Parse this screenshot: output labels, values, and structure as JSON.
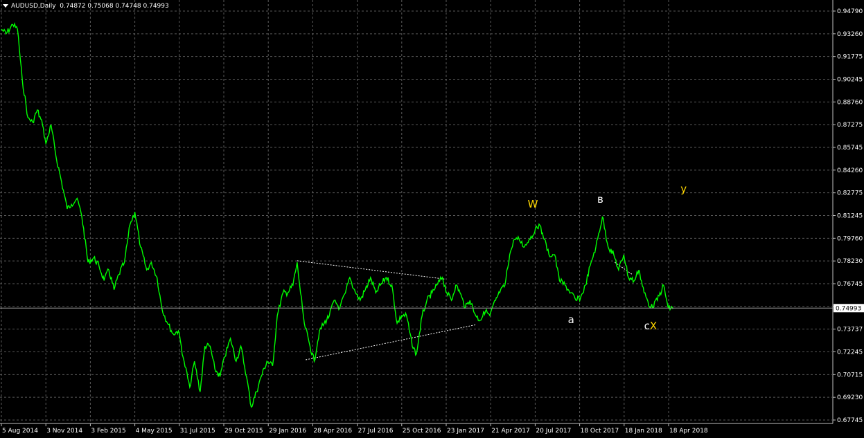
{
  "header": {
    "symbol": "AUDUSD,Daily",
    "ohlc": "0.74872 0.75068 0.74748 0.74993"
  },
  "colors": {
    "background": "#000000",
    "grid": "#5a5a5a",
    "price_line": "#00ff00",
    "axis_text": "#ffffff",
    "wave_label_yellow": "#ffd700",
    "wave_label_white": "#ffffff",
    "trendline": "#ffffff"
  },
  "chart_data": {
    "type": "line",
    "title": "",
    "xlabel": "",
    "ylabel": "",
    "ylim": [
      0.6774,
      0.9476
    ],
    "grid": true,
    "y_ticks": [
      "0.94790",
      "0.93260",
      "0.91775",
      "0.90245",
      "0.88760",
      "0.87275",
      "0.85745",
      "0.84260",
      "0.82775",
      "0.81245",
      "0.79760",
      "0.78230",
      "0.76745",
      "0.75260",
      "0.73737",
      "0.72245",
      "0.70715",
      "0.69230",
      "0.67745"
    ],
    "current_price": "0.74993",
    "x_ticks": [
      "5 Aug 2014",
      "3 Nov 2014",
      "3 Feb 2015",
      "4 May 2015",
      "31 Jul 2015",
      "29 Oct 2015",
      "29 Jan 2016",
      "28 Apr 2016",
      "27 Jul 2016",
      "25 Oct 2016",
      "23 Jan 2017",
      "21 Apr 2017",
      "20 Jul 2017",
      "18 Oct 2017",
      "18 Jan 2018",
      "18 Apr 2018"
    ],
    "x_range": [
      "2014-08-05",
      "2018-06-25"
    ],
    "series": [
      {
        "points": [
          [
            "2014-08-05",
            0.933
          ],
          [
            "2014-08-15",
            0.93
          ],
          [
            "2014-08-29",
            0.936
          ],
          [
            "2014-09-08",
            0.933
          ],
          [
            "2014-09-18",
            0.9
          ],
          [
            "2014-09-30",
            0.875
          ],
          [
            "2014-10-10",
            0.872
          ],
          [
            "2014-10-20",
            0.88
          ],
          [
            "2014-10-31",
            0.87
          ],
          [
            "2014-11-07",
            0.858
          ],
          [
            "2014-11-18",
            0.87
          ],
          [
            "2014-11-28",
            0.85
          ],
          [
            "2014-12-10",
            0.833
          ],
          [
            "2014-12-22",
            0.815
          ],
          [
            "2014-12-31",
            0.818
          ],
          [
            "2015-01-12",
            0.822
          ],
          [
            "2015-01-22",
            0.81
          ],
          [
            "2015-02-04",
            0.78
          ],
          [
            "2015-02-16",
            0.783
          ],
          [
            "2015-02-27",
            0.778
          ],
          [
            "2015-03-10",
            0.768
          ],
          [
            "2015-03-20",
            0.775
          ],
          [
            "2015-03-31",
            0.762
          ],
          [
            "2015-04-10",
            0.772
          ],
          [
            "2015-04-22",
            0.78
          ],
          [
            "2015-05-04",
            0.805
          ],
          [
            "2015-05-14",
            0.813
          ],
          [
            "2015-05-26",
            0.79
          ],
          [
            "2015-06-08",
            0.775
          ],
          [
            "2015-06-18",
            0.78
          ],
          [
            "2015-06-30",
            0.77
          ],
          [
            "2015-07-10",
            0.75
          ],
          [
            "2015-07-22",
            0.74
          ],
          [
            "2015-08-03",
            0.733
          ],
          [
            "2015-08-14",
            0.735
          ],
          [
            "2015-08-26",
            0.715
          ],
          [
            "2015-09-07",
            0.698
          ],
          [
            "2015-09-17",
            0.715
          ],
          [
            "2015-09-29",
            0.695
          ],
          [
            "2015-10-09",
            0.725
          ],
          [
            "2015-10-20",
            0.725
          ],
          [
            "2015-10-30",
            0.71
          ],
          [
            "2015-11-10",
            0.705
          ],
          [
            "2015-11-20",
            0.718
          ],
          [
            "2015-12-02",
            0.73
          ],
          [
            "2015-12-14",
            0.715
          ],
          [
            "2015-12-24",
            0.725
          ],
          [
            "2016-01-05",
            0.705
          ],
          [
            "2016-01-15",
            0.685
          ],
          [
            "2016-01-26",
            0.695
          ],
          [
            "2016-02-05",
            0.705
          ],
          [
            "2016-02-17",
            0.715
          ],
          [
            "2016-02-29",
            0.712
          ],
          [
            "2016-03-10",
            0.745
          ],
          [
            "2016-03-22",
            0.76
          ],
          [
            "2016-04-01",
            0.76
          ],
          [
            "2016-04-12",
            0.765
          ],
          [
            "2016-04-21",
            0.78
          ],
          [
            "2016-04-28",
            0.76
          ],
          [
            "2016-05-06",
            0.74
          ],
          [
            "2016-05-18",
            0.725
          ],
          [
            "2016-05-27",
            0.715
          ],
          [
            "2016-06-07",
            0.735
          ],
          [
            "2016-06-17",
            0.74
          ],
          [
            "2016-06-28",
            0.745
          ],
          [
            "2016-07-08",
            0.755
          ],
          [
            "2016-07-20",
            0.75
          ],
          [
            "2016-08-01",
            0.76
          ],
          [
            "2016-08-10",
            0.77
          ],
          [
            "2016-08-22",
            0.76
          ],
          [
            "2016-09-01",
            0.755
          ],
          [
            "2016-09-12",
            0.762
          ],
          [
            "2016-09-23",
            0.77
          ],
          [
            "2016-10-04",
            0.76
          ],
          [
            "2016-10-14",
            0.765
          ],
          [
            "2016-10-26",
            0.77
          ],
          [
            "2016-11-07",
            0.765
          ],
          [
            "2016-11-18",
            0.74
          ],
          [
            "2016-11-28",
            0.745
          ],
          [
            "2016-12-08",
            0.745
          ],
          [
            "2016-12-20",
            0.725
          ],
          [
            "2016-12-29",
            0.72
          ],
          [
            "2017-01-10",
            0.745
          ],
          [
            "2017-01-20",
            0.755
          ],
          [
            "2017-01-31",
            0.76
          ],
          [
            "2017-02-10",
            0.765
          ],
          [
            "2017-02-22",
            0.77
          ],
          [
            "2017-03-03",
            0.76
          ],
          [
            "2017-03-13",
            0.755
          ],
          [
            "2017-03-22",
            0.765
          ],
          [
            "2017-03-31",
            0.76
          ],
          [
            "2017-04-11",
            0.75
          ],
          [
            "2017-04-21",
            0.755
          ],
          [
            "2017-05-03",
            0.745
          ],
          [
            "2017-05-12",
            0.742
          ],
          [
            "2017-05-24",
            0.748
          ],
          [
            "2017-06-02",
            0.745
          ],
          [
            "2017-06-14",
            0.755
          ],
          [
            "2017-06-23",
            0.76
          ],
          [
            "2017-07-04",
            0.765
          ],
          [
            "2017-07-14",
            0.785
          ],
          [
            "2017-07-24",
            0.795
          ],
          [
            "2017-08-03",
            0.795
          ],
          [
            "2017-08-14",
            0.79
          ],
          [
            "2017-08-24",
            0.795
          ],
          [
            "2017-09-05",
            0.8
          ],
          [
            "2017-09-14",
            0.805
          ],
          [
            "2017-09-25",
            0.795
          ],
          [
            "2017-10-05",
            0.785
          ],
          [
            "2017-10-17",
            0.785
          ],
          [
            "2017-10-27",
            0.768
          ],
          [
            "2017-11-08",
            0.765
          ],
          [
            "2017-11-20",
            0.76
          ],
          [
            "2017-12-01",
            0.755
          ],
          [
            "2017-12-11",
            0.757
          ],
          [
            "2017-12-21",
            0.765
          ],
          [
            "2018-01-02",
            0.78
          ],
          [
            "2018-01-12",
            0.79
          ],
          [
            "2018-01-26",
            0.81
          ],
          [
            "2018-02-07",
            0.79
          ],
          [
            "2018-02-19",
            0.785
          ],
          [
            "2018-03-01",
            0.775
          ],
          [
            "2018-03-12",
            0.785
          ],
          [
            "2018-03-22",
            0.77
          ],
          [
            "2018-04-03",
            0.768
          ],
          [
            "2018-04-13",
            0.775
          ],
          [
            "2018-04-24",
            0.76
          ],
          [
            "2018-05-08",
            0.75
          ],
          [
            "2018-05-22",
            0.755
          ],
          [
            "2018-06-04",
            0.765
          ],
          [
            "2018-06-14",
            0.75
          ],
          [
            "2018-06-25",
            0.7499
          ]
        ]
      }
    ],
    "trendlines": [
      {
        "from": [
          "2016-04-21",
          0.781
        ],
        "to": [
          "2017-02-27",
          0.769
        ]
      },
      {
        "from": [
          "2016-05-09",
          0.716
        ],
        "to": [
          "2017-05-03",
          0.739
        ]
      },
      {
        "from": [
          "2018-02-21",
          0.78
        ],
        "to": [
          "2018-03-30",
          0.772
        ]
      }
    ],
    "annotations": [
      {
        "text": "W",
        "x": "2017-08-21",
        "y": 0.816,
        "color": "#ffd700"
      },
      {
        "text": "в",
        "x": "2018-01-15",
        "y": 0.819,
        "color": "#ffffff"
      },
      {
        "text": "у",
        "x": "2018-07-10",
        "y": 0.826,
        "color": "#ffd700"
      },
      {
        "text": "a",
        "x": "2017-11-14",
        "y": 0.74,
        "color": "#ffffff"
      },
      {
        "text": "c",
        "x": "2018-04-24",
        "y": 0.736,
        "color": "#ffffff"
      },
      {
        "text": "X",
        "x": "2018-05-06",
        "y": 0.736,
        "color": "#ffd700"
      }
    ]
  }
}
